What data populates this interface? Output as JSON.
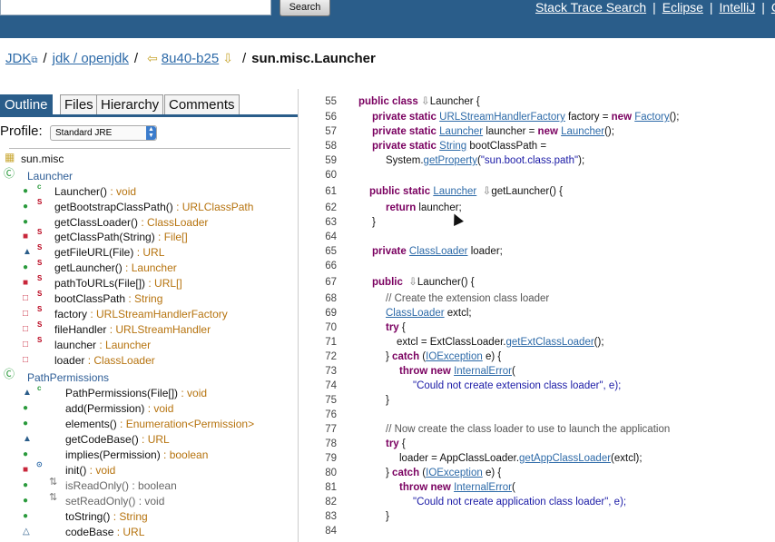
{
  "top": {
    "search_button": "Search",
    "links": [
      "Stack Trace Search",
      "Eclipse",
      "IntelliJ",
      "C"
    ]
  },
  "breadcrumb": {
    "jdk": "JDK",
    "repo": "jdk / openjdk",
    "version": "8u40-b25",
    "class": "sun.misc.Launcher"
  },
  "tabs": [
    "Outline",
    "Files",
    "Hierarchy",
    "Comments"
  ],
  "profile": {
    "label": "Profile:",
    "value": "Standard JRE"
  },
  "outline": [
    {
      "name": "sun.misc",
      "type": ""
    },
    {
      "name": "Launcher",
      "type": ""
    },
    {
      "name": "Launcher()",
      "type": " : void"
    },
    {
      "name": "getBootstrapClassPath()",
      "type": " : URLClassPath"
    },
    {
      "name": "getClassLoader()",
      "type": " : ClassLoader"
    },
    {
      "name": "getClassPath(String)",
      "type": " : File[]"
    },
    {
      "name": "getFileURL(File)",
      "type": " : URL"
    },
    {
      "name": "getLauncher()",
      "type": " : Launcher"
    },
    {
      "name": "pathToURLs(File[])",
      "type": " : URL[]"
    },
    {
      "name": "bootClassPath",
      "type": " : String"
    },
    {
      "name": "factory",
      "type": " : URLStreamHandlerFactory"
    },
    {
      "name": "fileHandler",
      "type": " : URLStreamHandler"
    },
    {
      "name": "launcher",
      "type": " : Launcher"
    },
    {
      "name": "loader",
      "type": " : ClassLoader"
    },
    {
      "name": "PathPermissions",
      "type": ""
    },
    {
      "name": "PathPermissions(File[])",
      "type": " : void"
    },
    {
      "name": "add(Permission)",
      "type": " : void"
    },
    {
      "name": "elements()",
      "type": " : Enumeration<Permission>"
    },
    {
      "name": "getCodeBase()",
      "type": " : URL"
    },
    {
      "name": "implies(Permission)",
      "type": " : boolean"
    },
    {
      "name": "init()",
      "type": " : void"
    },
    {
      "name": "isReadOnly()",
      "type": " : boolean"
    },
    {
      "name": "setReadOnly()",
      "type": " : void"
    },
    {
      "name": "toString()",
      "type": " : String"
    },
    {
      "name": "codeBase",
      "type": " : URL"
    }
  ],
  "code": [
    {
      "n": "55",
      "s": "public class Launcher {"
    },
    {
      "n": "56",
      "s": "private static URLStreamHandlerFactory factory = new Factory();"
    },
    {
      "n": "57",
      "s": "private static Launcher launcher = new Launcher();"
    },
    {
      "n": "58",
      "s": "private static String bootClassPath ="
    },
    {
      "n": "59",
      "s": "System.getProperty(\"sun.boot.class.path\");"
    },
    {
      "n": "60",
      "s": ""
    },
    {
      "n": "61",
      "s": "public static Launcher getLauncher() {"
    },
    {
      "n": "62",
      "s": "return launcher;"
    },
    {
      "n": "63",
      "s": "}"
    },
    {
      "n": "64",
      "s": ""
    },
    {
      "n": "65",
      "s": "private ClassLoader loader;"
    },
    {
      "n": "66",
      "s": ""
    },
    {
      "n": "67",
      "s": "public Launcher() {"
    },
    {
      "n": "68",
      "s": "// Create the extension class loader"
    },
    {
      "n": "69",
      "s": "ClassLoader extcl;"
    },
    {
      "n": "70",
      "s": "try {"
    },
    {
      "n": "71",
      "s": "extcl = ExtClassLoader.getExtClassLoader();"
    },
    {
      "n": "72",
      "s": "} catch (IOException e) {"
    },
    {
      "n": "73",
      "s": "throw new InternalError("
    },
    {
      "n": "74",
      "s": "\"Could not create extension class loader\", e);"
    },
    {
      "n": "75",
      "s": "}"
    },
    {
      "n": "76",
      "s": ""
    },
    {
      "n": "77",
      "s": "// Now create the class loader to use to launch the application"
    },
    {
      "n": "78",
      "s": "try {"
    },
    {
      "n": "79",
      "s": "loader = AppClassLoader.getAppClassLoader(extcl);"
    },
    {
      "n": "80",
      "s": "} catch (IOException e) {"
    },
    {
      "n": "81",
      "s": "throw new InternalError("
    },
    {
      "n": "82",
      "s": "\"Could not create application class loader\", e);"
    },
    {
      "n": "83",
      "s": "}"
    },
    {
      "n": "84",
      "s": ""
    }
  ]
}
